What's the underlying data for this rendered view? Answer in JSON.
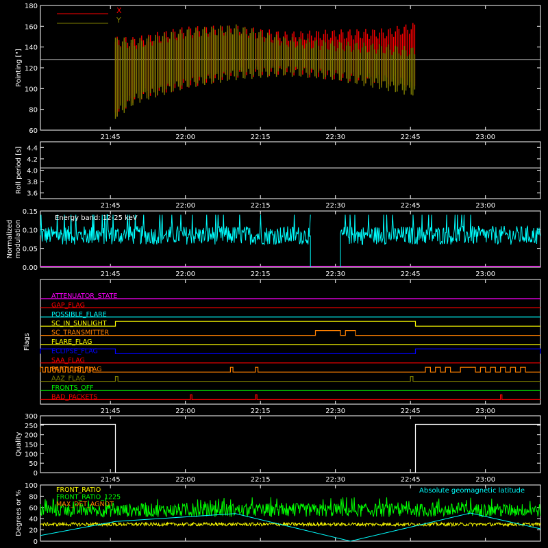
{
  "time_ticks": [
    "21:45",
    "22:00",
    "22:15",
    "22:30",
    "22:45",
    "23:00"
  ],
  "colors": {
    "axis": "#ffffff",
    "x_series": "#ff0000",
    "y_series": "#808000",
    "cyan": "#00ffff",
    "magenta": "#ff00ff",
    "green": "#00ff00",
    "yellow": "#ffff00",
    "orange": "#ff8000",
    "blue": "#0000ff",
    "red": "#ff0000",
    "olive": "#808000"
  },
  "chart_data": [
    {
      "id": "pointing",
      "type": "area",
      "ylabel": "Pointing [\"]",
      "xlim": [
        "21:31",
        "23:11"
      ],
      "ylim": [
        60,
        180
      ],
      "yticks": [
        60,
        80,
        100,
        120,
        140,
        160,
        180
      ],
      "legend_position": "top-left",
      "reference_line": 128,
      "series": [
        {
          "name": "X",
          "color": "#ff0000",
          "x": [
            "21:46",
            "21:50",
            "22:00",
            "22:10",
            "22:20",
            "22:30",
            "22:40",
            "22:46"
          ],
          "upper": [
            150,
            150,
            160,
            161,
            155,
            157,
            158,
            164
          ],
          "lower": [
            72,
            88,
            100,
            110,
            113,
            108,
            103,
            100
          ]
        },
        {
          "name": "Y",
          "color": "#808000",
          "x": [
            "21:46",
            "21:50",
            "22:00",
            "22:10",
            "22:20",
            "22:30",
            "22:40",
            "22:46"
          ],
          "upper": [
            150,
            148,
            158,
            162,
            150,
            146,
            143,
            140
          ],
          "lower": [
            70,
            85,
            100,
            108,
            112,
            108,
            98,
            92
          ]
        }
      ]
    },
    {
      "id": "roll_period",
      "type": "line",
      "ylabel": "Roll period [s]",
      "ylim": [
        3.5,
        4.5
      ],
      "yticks": [
        "3.6",
        "3.8",
        "4.0",
        "4.2",
        "4.4"
      ],
      "series": [
        {
          "color": "#ffffff",
          "x": [
            "21:31",
            "23:11"
          ],
          "y": [
            4.04,
            4.04
          ]
        }
      ]
    },
    {
      "id": "modulation",
      "type": "line",
      "ylabel": "Normalized modulation",
      "ylim": [
        0,
        0.15
      ],
      "yticks": [
        "0.00",
        "0.05",
        "0.10",
        "0.15"
      ],
      "annotations": [
        "Energy band: 12-25 keV"
      ],
      "series": [
        {
          "color": "#00ffff",
          "typical": 0.085,
          "spread": 0.025,
          "segments": [
            [
              "21:31",
              "22:25"
            ],
            [
              "22:31",
              "23:11"
            ]
          ]
        },
        {
          "color": "#ff00ff",
          "x": [
            "21:31",
            "23:11"
          ],
          "y": [
            0,
            0
          ]
        }
      ]
    },
    {
      "id": "flags",
      "type": "line",
      "ylabel": "Flags",
      "flags": [
        {
          "name": "ATTENUATOR_STATE",
          "color": "#ff00ff",
          "on": []
        },
        {
          "name": "GAP_FLAG",
          "color": "#ff0000",
          "on": []
        },
        {
          "name": "POSSIBLE_FLARE",
          "color": "#00ffff",
          "on": []
        },
        {
          "name": "SC_IN_SUNLIGHT",
          "color": "#ffff00",
          "on": [
            [
              "21:46",
              "22:46"
            ]
          ]
        },
        {
          "name": "SC_TRANSMITTER",
          "color": "#ff8000",
          "on": [
            [
              "22:26",
              "22:31"
            ],
            [
              "22:32",
              "22:34"
            ]
          ]
        },
        {
          "name": "FLARE_FLAG",
          "color": "#ffff00",
          "on": []
        },
        {
          "name": "ECLIPSE_FLAG",
          "color": "#0000ff",
          "on": [
            [
              "21:31",
              "21:46"
            ],
            [
              "22:46",
              "23:11"
            ]
          ]
        },
        {
          "name": "SAA_FLAG",
          "color": "#ff0000",
          "on": []
        },
        {
          "name": "PARTICLE_FLAG",
          "color": "#ff8000",
          "on": [
            [
              "21:31",
              "21:31.5"
            ],
            [
              "21:32",
              "21:32.5"
            ],
            [
              "21:33",
              "21:33.5"
            ],
            [
              "21:34",
              "21:34.5"
            ],
            [
              "21:35",
              "21:35.5"
            ],
            [
              "21:36",
              "21:36.5"
            ],
            [
              "21:37",
              "21:37.5"
            ],
            [
              "21:38",
              "21:38.5"
            ],
            [
              "21:39",
              "21:39.5"
            ],
            [
              "21:40",
              "21:40.5"
            ],
            [
              "21:41",
              "21:41.5"
            ],
            [
              "22:09",
              "22:09.5"
            ],
            [
              "22:14",
              "22:14.5"
            ],
            [
              "22:48",
              "22:49"
            ],
            [
              "22:50",
              "22:51"
            ],
            [
              "22:52",
              "22:53"
            ],
            [
              "22:55",
              "22:58"
            ],
            [
              "22:59",
              "23:00"
            ],
            [
              "23:01",
              "23:02"
            ],
            [
              "23:03",
              "23:04"
            ],
            [
              "23:05",
              "23:06"
            ],
            [
              "23:07",
              "23:08"
            ]
          ]
        },
        {
          "name": "AAZ_FLAG",
          "color": "#808000",
          "on": [
            [
              "21:46",
              "21:46.5"
            ],
            [
              "22:45",
              "22:45.5"
            ]
          ]
        },
        {
          "name": "FRONTS_OFF",
          "color": "#00ff00",
          "on": []
        },
        {
          "name": "BAD_PACKETS",
          "color": "#ff0000",
          "on": [
            [
              "22:01",
              "22:01.3"
            ],
            [
              "22:14",
              "22:14.3"
            ],
            [
              "23:03",
              "23:03.3"
            ]
          ]
        }
      ]
    },
    {
      "id": "quality",
      "type": "line",
      "ylabel": "Quality",
      "ylim": [
        0,
        300
      ],
      "yticks": [
        "0",
        "50",
        "100",
        "150",
        "200",
        "250",
        "300"
      ],
      "series": [
        {
          "color": "#ffffff",
          "x": [
            "21:31",
            "21:46",
            "21:46",
            "22:46",
            "22:46",
            "23:11"
          ],
          "y": [
            255,
            255,
            0,
            0,
            255,
            255
          ]
        }
      ]
    },
    {
      "id": "ratios",
      "type": "line",
      "ylabel": "Degrees or %",
      "ylim": [
        0,
        100
      ],
      "yticks": [
        "0",
        "20",
        "40",
        "60",
        "80",
        "100"
      ],
      "legend_position": "top-left",
      "right_label": "Absolute geomagnetic latitude",
      "right_label_color": "#00ffff",
      "series": [
        {
          "name": "FRONT_RATIO",
          "color": "#ffff00",
          "typical": 30,
          "spread": 3
        },
        {
          "name": "FRONT_RATIO_1225",
          "color": "#00ff00",
          "typical": 55,
          "spread": 12
        },
        {
          "name": "MAX_DET_AGNOT",
          "color": "#ff8000"
        },
        {
          "name": "Absolute geomagnetic latitude",
          "color": "#00ffff",
          "x": [
            "21:31",
            "21:46",
            "22:10",
            "22:33",
            "22:57",
            "23:11"
          ],
          "y": [
            10,
            35,
            49,
            0,
            50,
            22
          ]
        }
      ]
    }
  ]
}
